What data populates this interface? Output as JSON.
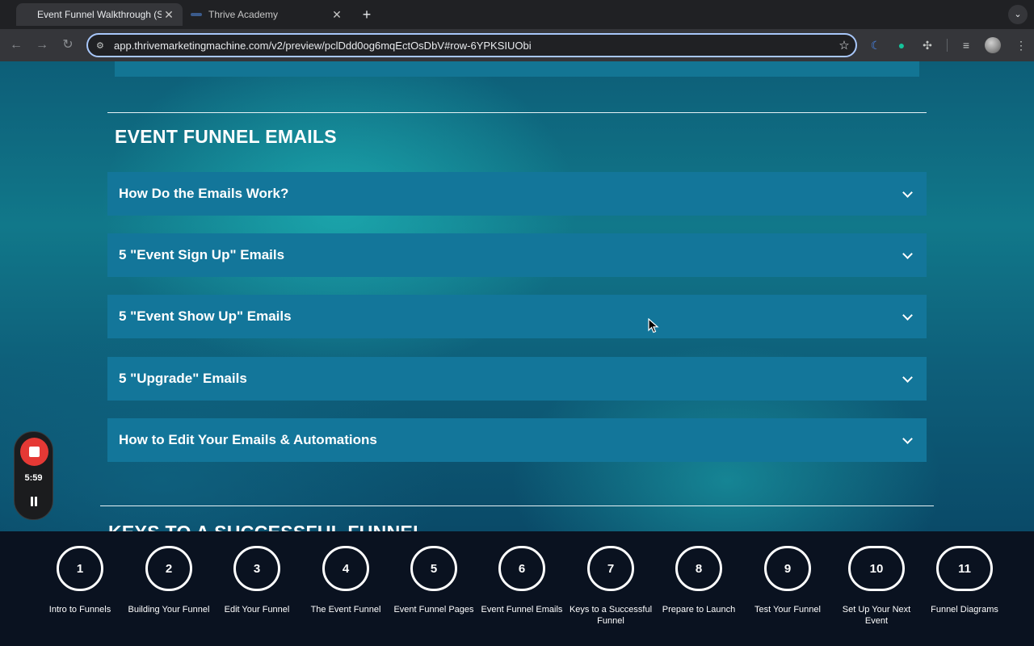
{
  "browser": {
    "tabs": [
      {
        "title": "Event Funnel Walkthrough (S",
        "active": true
      },
      {
        "title": "Thrive Academy",
        "active": false
      }
    ],
    "url": "app.thrivemarketingmachine.com/v2/preview/pclDdd0og6mqEctOsDbV#row-6YPKSIUObi"
  },
  "colors": {
    "accordion_bg": "#13769a",
    "page_bg": "#0d5e78",
    "stepbar_bg": "#0a1220",
    "recorder_stop": "#e53935"
  },
  "section": {
    "title": "EVENT FUNNEL EMAILS",
    "accordions": [
      {
        "label": "How Do the Emails Work?",
        "icon": "chevron-down-icon"
      },
      {
        "label": "5 \"Event Sign Up\" Emails",
        "icon": "chevron-down-icon"
      },
      {
        "label": "5 \"Event Show Up\" Emails",
        "icon": "chevron-down-icon"
      },
      {
        "label": "5 \"Upgrade\" Emails",
        "icon": "chevron-down-icon"
      },
      {
        "label": "How to Edit Your Emails & Automations",
        "icon": "chevron-down-icon"
      }
    ],
    "next_title": "KEYS TO A SUCCESSFUL FUNNEL"
  },
  "recorder": {
    "time": "5:59"
  },
  "steps": [
    {
      "number": "1",
      "label": "Intro to Funnels"
    },
    {
      "number": "2",
      "label": "Building Your Funnel"
    },
    {
      "number": "3",
      "label": "Edit Your Funnel"
    },
    {
      "number": "4",
      "label": "The Event Funnel"
    },
    {
      "number": "5",
      "label": "Event Funnel Pages"
    },
    {
      "number": "6",
      "label": "Event Funnel Emails"
    },
    {
      "number": "7",
      "label": "Keys to a Successful Funnel"
    },
    {
      "number": "8",
      "label": "Prepare to Launch"
    },
    {
      "number": "9",
      "label": "Test Your Funnel"
    },
    {
      "number": "10",
      "label": "Set Up Your Next Event"
    },
    {
      "number": "11",
      "label": "Funnel Diagrams"
    }
  ]
}
